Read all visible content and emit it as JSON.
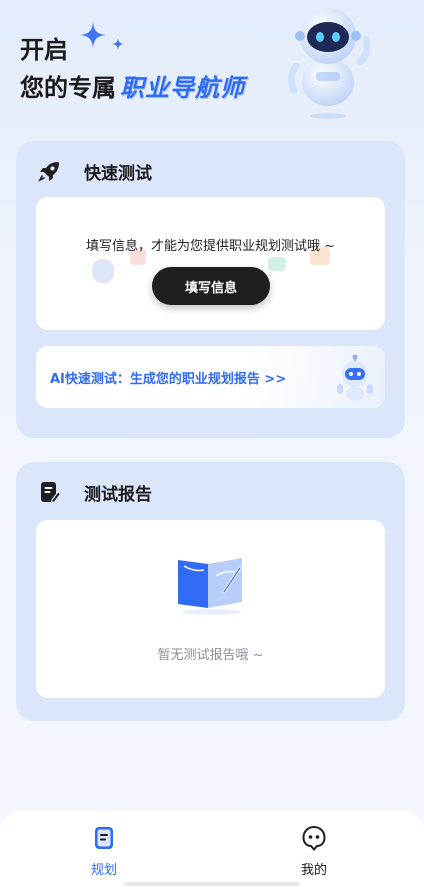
{
  "hero": {
    "line1": "开启",
    "line2_prefix": "您的专属",
    "line2_accent": "职业导航师"
  },
  "quick_test": {
    "title": "快速测试",
    "icon": "rocket-icon",
    "fill_prompt": "填写信息，才能为您提供职业规划测试哦 ~",
    "fill_button": "填写信息",
    "ai_banner": "AI快速测试：生成您的职业规划报告 >>"
  },
  "report": {
    "title": "测试报告",
    "icon": "report-edit-icon",
    "empty_text": "暂无测试报告哦 ~"
  },
  "tabbar": {
    "tabs": [
      {
        "label": "规划",
        "icon": "plan-document-icon",
        "active": true
      },
      {
        "label": "我的",
        "icon": "profile-face-icon",
        "active": false
      }
    ]
  },
  "colors": {
    "accent": "#2f6bf5",
    "card_bg": "#dbe6fa",
    "button_dark": "#1f1f21"
  }
}
